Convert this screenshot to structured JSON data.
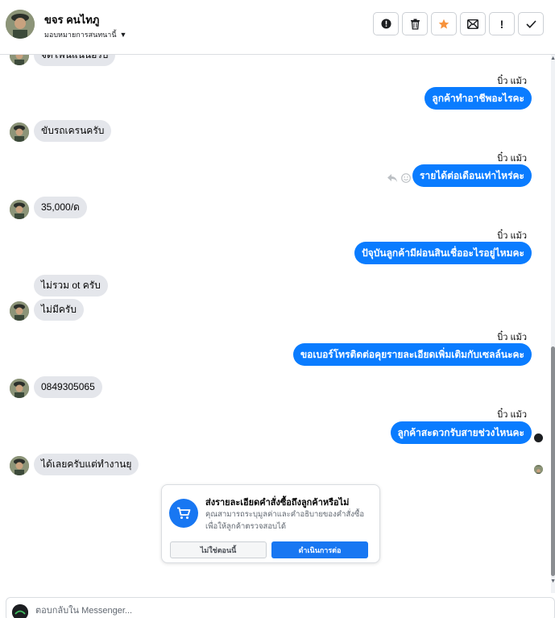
{
  "header": {
    "contact_name": "ขจร คนไทภู",
    "assign_label": "มอบหมายการสนทนานี้",
    "toolbar": [
      {
        "name": "alert-button",
        "icon": "alert-circle-icon"
      },
      {
        "name": "delete-button",
        "icon": "trash-icon"
      },
      {
        "name": "star-button",
        "icon": "star-icon"
      },
      {
        "name": "mark-unread-button",
        "icon": "envelope-icon"
      },
      {
        "name": "follow-up-button",
        "icon": "exclamation-icon"
      },
      {
        "name": "done-button",
        "icon": "check-icon"
      }
    ]
  },
  "conversation": {
    "page_sender": "บิ๋ว แม้ว",
    "messages": [
      {
        "dir": "in",
        "text": "จดโฟนแนนอรบ"
      },
      {
        "dir": "out",
        "sender": "บิ๋ว แม้ว",
        "text": "ลูกค้าทำอาชีพอะไรคะ"
      },
      {
        "dir": "in",
        "text": "ขับรถเครนครับ"
      },
      {
        "dir": "out",
        "sender": "บิ๋ว แม้ว",
        "text": "รายได้ต่อเดือนเท่าไหร่คะ"
      },
      {
        "dir": "in",
        "text": "35,000/ด"
      },
      {
        "dir": "out",
        "sender": "บิ๋ว แม้ว",
        "text": "ปัจุบันลูกค้ามีผ่อนสินเชื่ออะไรอยู่ไหมคะ"
      },
      {
        "dir": "in",
        "text": "ไม่รวม ot ครับ"
      },
      {
        "dir": "in",
        "text": "ไม่มีครับ"
      },
      {
        "dir": "out",
        "sender": "บิ๋ว แม้ว",
        "text": "ขอเบอร์โทรติดต่อคุยรายละเอียดเพิ่มเติมกับเซลล์นะคะ"
      },
      {
        "dir": "in",
        "text": "0849305065"
      },
      {
        "dir": "out",
        "sender": "บิ๋ว แม้ว",
        "text": "ลูกค้าสะดวกรับสายช่วงไหนคะ"
      },
      {
        "dir": "in",
        "text": "ได้เลยครับแต่ทำงานยุ"
      }
    ]
  },
  "prompt_card": {
    "title": "ส่งรายละเอียดคำสั่งซื้อถึงลูกค้าหรือไม่",
    "body": "คุณสามารถระบุมูลค่าและคำอธิบายของคำสั่งซื้อเพื่อให้ลูกค้าตรวจสอบได้",
    "secondary_label": "ไม่ใช่ตอนนี้",
    "primary_label": "ดำเนินการต่อ",
    "icon": "cart-icon"
  },
  "composer": {
    "placeholder": "ตอบกลับใน Messenger..."
  },
  "colors": {
    "outgoing": "#0a7cff",
    "incoming": "#e4e6eb",
    "accent": "#1877f2",
    "star": "#f7923b"
  }
}
